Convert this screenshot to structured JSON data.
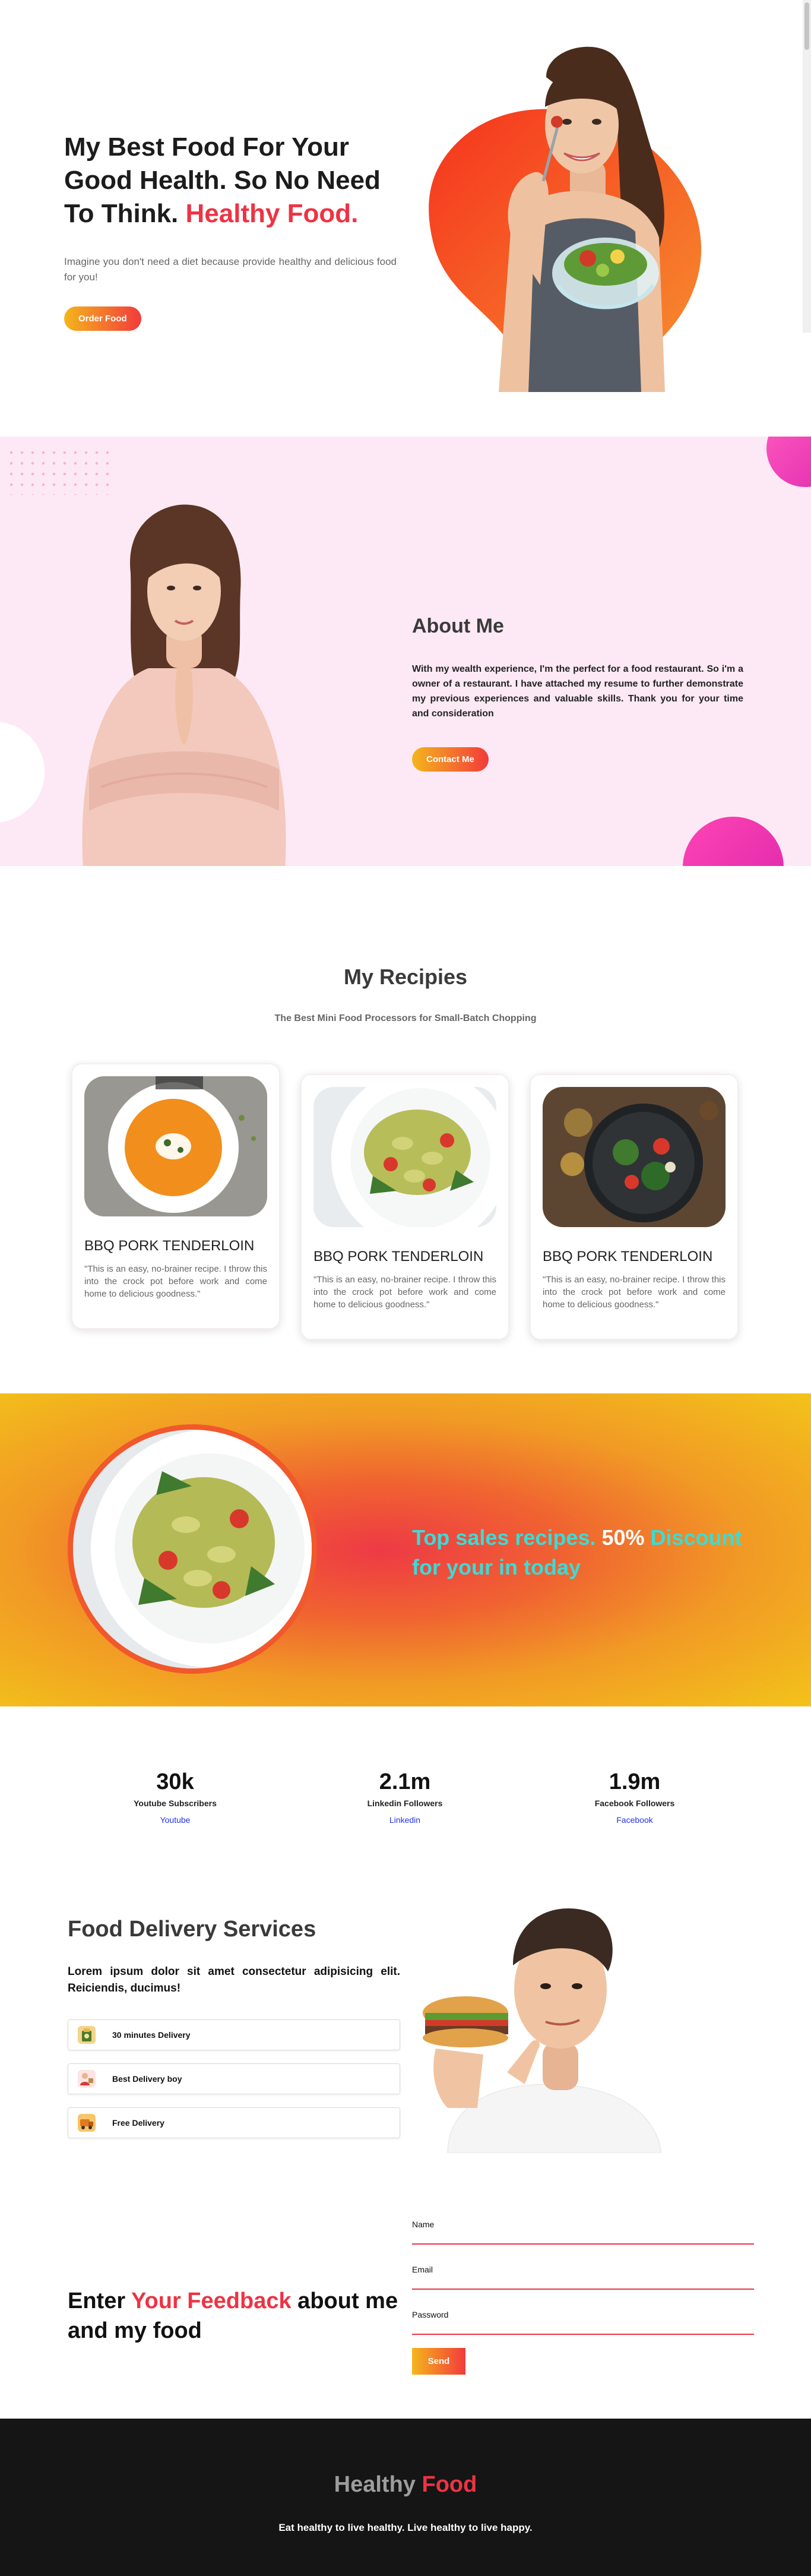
{
  "hero": {
    "title_main": "My Best Food For Your Good Health. So No Need To Think. ",
    "title_accent": "Healthy Food.",
    "description": "Imagine you don't need a diet because provide healthy and delicious food for you!",
    "button": "Order Food"
  },
  "about": {
    "title": "About Me",
    "description": "With my wealth experience, I'm the perfect for a food restaurant. So i'm a owner of a restaurant. I have attached my resume to further demonstrate my previous experiences and valuable skills. Thank you for your time and consideration",
    "button": "Contact Me"
  },
  "recipes": {
    "title": "My Recipies",
    "subtitle": "The Best Mini Food Processors for Small-Batch Chopping",
    "cards": [
      {
        "title": "BBQ PORK TENDERLOIN",
        "description": "\"This is an easy, no-brainer recipe. I throw this into the crock pot before work and come home to delicious goodness.\"",
        "image": "pumpkin-soup-bowl"
      },
      {
        "title": "BBQ PORK TENDERLOIN",
        "description": "\"This is an easy, no-brainer recipe. I throw this into the crock pot before work and come home to delicious goodness.\"",
        "image": "pasta-salad-plate"
      },
      {
        "title": "BBQ PORK TENDERLOIN",
        "description": "\"This is an easy, no-brainer recipe. I throw this into the crock pot before work and come home to delicious goodness.\"",
        "image": "veggie-skillet"
      }
    ]
  },
  "promo": {
    "part1": "Top sales recipes. ",
    "part2": "50%",
    "part3": " Discount for your in today"
  },
  "stats": [
    {
      "value": "30k",
      "label": "Youtube Subscribers",
      "link": "Youtube"
    },
    {
      "value": "2.1m",
      "label": "Linkedin Followers",
      "link": "Linkedin"
    },
    {
      "value": "1.9m",
      "label": "Facebook Followers",
      "link": "Facebook"
    }
  ],
  "delivery": {
    "title": "Food Delivery Services",
    "description": "Lorem ipsum dolor sit amet consectetur adipisicing elit. Reiciendis, ducimus!",
    "features": [
      {
        "label": "30 minutes Delivery",
        "icon": "food-package-icon"
      },
      {
        "label": "Best Delivery boy",
        "icon": "delivery-person-icon"
      },
      {
        "label": "Free Delivery",
        "icon": "free-delivery-icon"
      }
    ]
  },
  "feedback": {
    "title_pre": "Enter ",
    "title_accent": "Your Feedback",
    "title_post": " about me and my food",
    "fields": {
      "name": "Name",
      "email": "Email",
      "password": "Password"
    },
    "button": "Send"
  },
  "footer": {
    "brand_main": "Healthy ",
    "brand_accent": "Food",
    "tagline": "Eat healthy to live healthy. Live healthy to live happy."
  },
  "colors": {
    "accent": "#ee3344",
    "gradient_start": "#f5b51c",
    "gradient_end": "#f23b3b",
    "pink_bg": "#fde9f5",
    "teal": "#39dcd7",
    "link": "#2333e8",
    "footer_bg": "#151515"
  }
}
